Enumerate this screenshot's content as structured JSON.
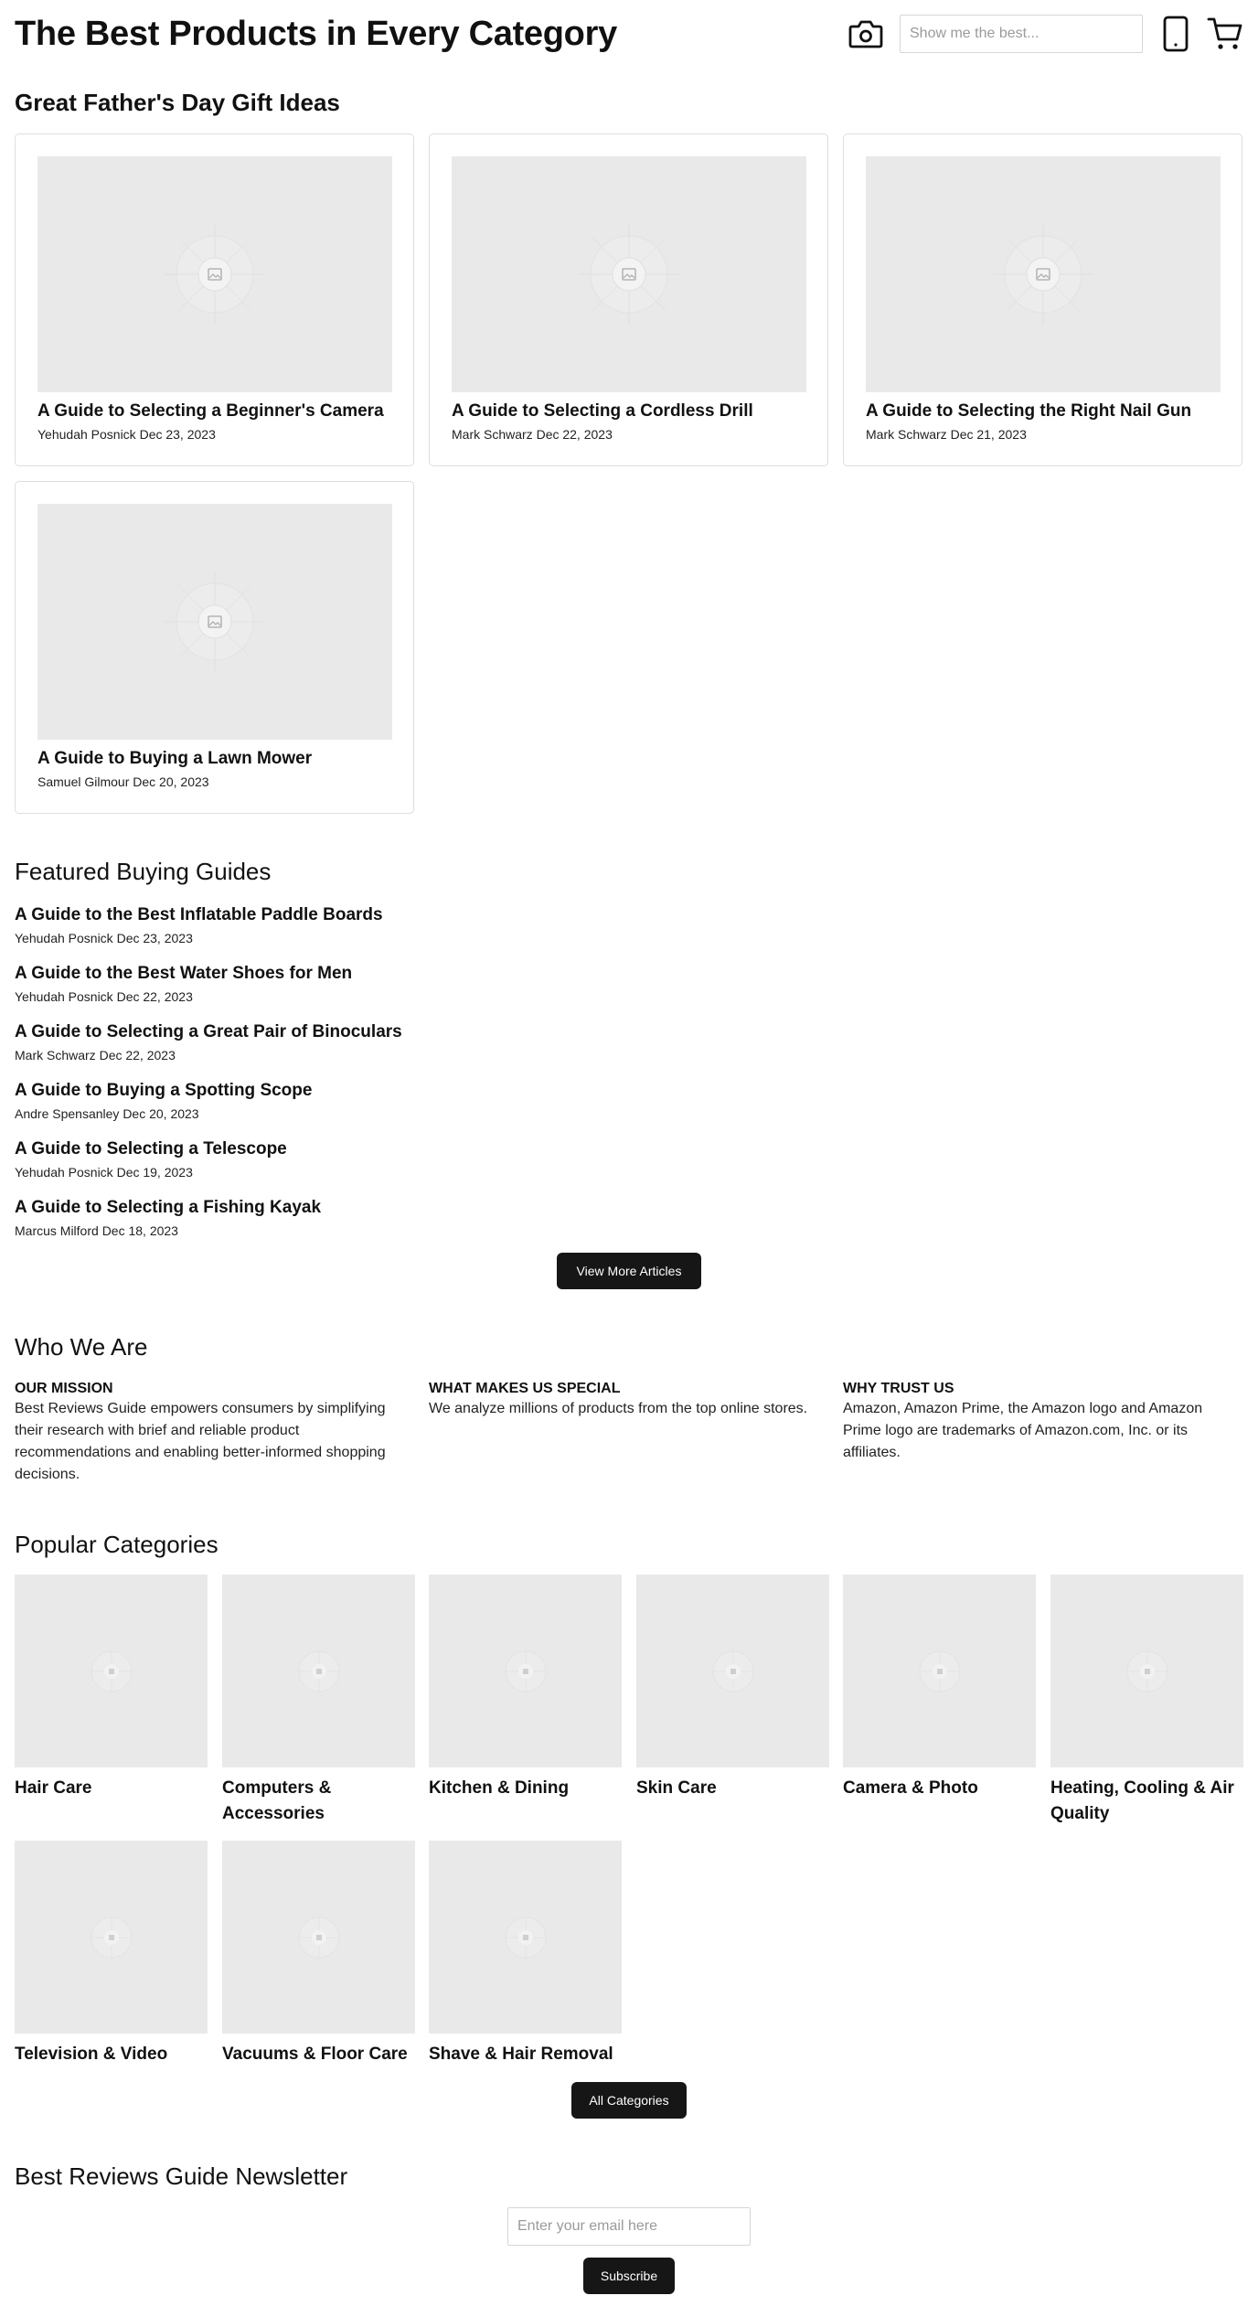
{
  "header": {
    "title": "The Best Products in Every Category",
    "search_placeholder": "Show me the best...",
    "icons": [
      "camera-icon",
      "tablet-icon",
      "cart-icon"
    ]
  },
  "gift_section": {
    "title": "Great Father's Day Gift Ideas",
    "cards": [
      {
        "title": "A Guide to Selecting a Beginner's Camera",
        "author": "Yehudah Posnick",
        "date": "Dec 23, 2023"
      },
      {
        "title": "A Guide to Selecting a Cordless Drill",
        "author": "Mark Schwarz",
        "date": "Dec 22, 2023"
      },
      {
        "title": "A Guide to Selecting the Right Nail Gun",
        "author": "Mark Schwarz",
        "date": "Dec 21, 2023"
      },
      {
        "title": "A Guide to Buying a Lawn Mower",
        "author": "Samuel Gilmour",
        "date": "Dec 20, 2023"
      }
    ]
  },
  "featured": {
    "title": "Featured Buying Guides",
    "guides": [
      {
        "title": "A Guide to the Best Inflatable Paddle Boards",
        "author": "Yehudah Posnick",
        "date": "Dec 23, 2023"
      },
      {
        "title": "A Guide to the Best Water Shoes for Men",
        "author": "Yehudah Posnick",
        "date": "Dec 22, 2023"
      },
      {
        "title": "A Guide to Selecting a Great Pair of Binoculars",
        "author": "Mark Schwarz",
        "date": "Dec 22, 2023"
      },
      {
        "title": "A Guide to Buying a Spotting Scope",
        "author": "Andre Spensanley",
        "date": "Dec 20, 2023"
      },
      {
        "title": "A Guide to Selecting a Telescope",
        "author": "Yehudah Posnick",
        "date": "Dec 19, 2023"
      },
      {
        "title": "A Guide to Selecting a Fishing Kayak",
        "author": "Marcus Milford",
        "date": "Dec 18, 2023"
      }
    ],
    "button_label": "View More Articles"
  },
  "who": {
    "title": "Who We Are",
    "columns": [
      {
        "heading": "OUR MISSION",
        "body": "Best Reviews Guide empowers consumers by simplifying their research with brief and reliable product recommendations and enabling better-informed shopping decisions."
      },
      {
        "heading": "WHAT MAKES US SPECIAL",
        "body": "We analyze millions of products from the top online stores."
      },
      {
        "heading": "WHY TRUST US",
        "body": "Amazon, Amazon Prime, the Amazon logo and Amazon Prime logo are trademarks of Amazon.com, Inc. or its affiliates."
      }
    ]
  },
  "categories": {
    "title": "Popular Categories",
    "items": [
      {
        "label": "Hair Care"
      },
      {
        "label": "Computers & Accessories"
      },
      {
        "label": "Kitchen & Dining"
      },
      {
        "label": "Skin Care"
      },
      {
        "label": "Camera & Photo"
      },
      {
        "label": "Heating, Cooling & Air Quality"
      },
      {
        "label": "Television & Video"
      },
      {
        "label": "Vacuums & Floor Care"
      },
      {
        "label": "Shave & Hair Removal"
      }
    ],
    "button_label": "All Categories"
  },
  "newsletter": {
    "title": "Best Reviews Guide Newsletter",
    "email_placeholder": "Enter your email here",
    "button_label": "Subscribe"
  }
}
